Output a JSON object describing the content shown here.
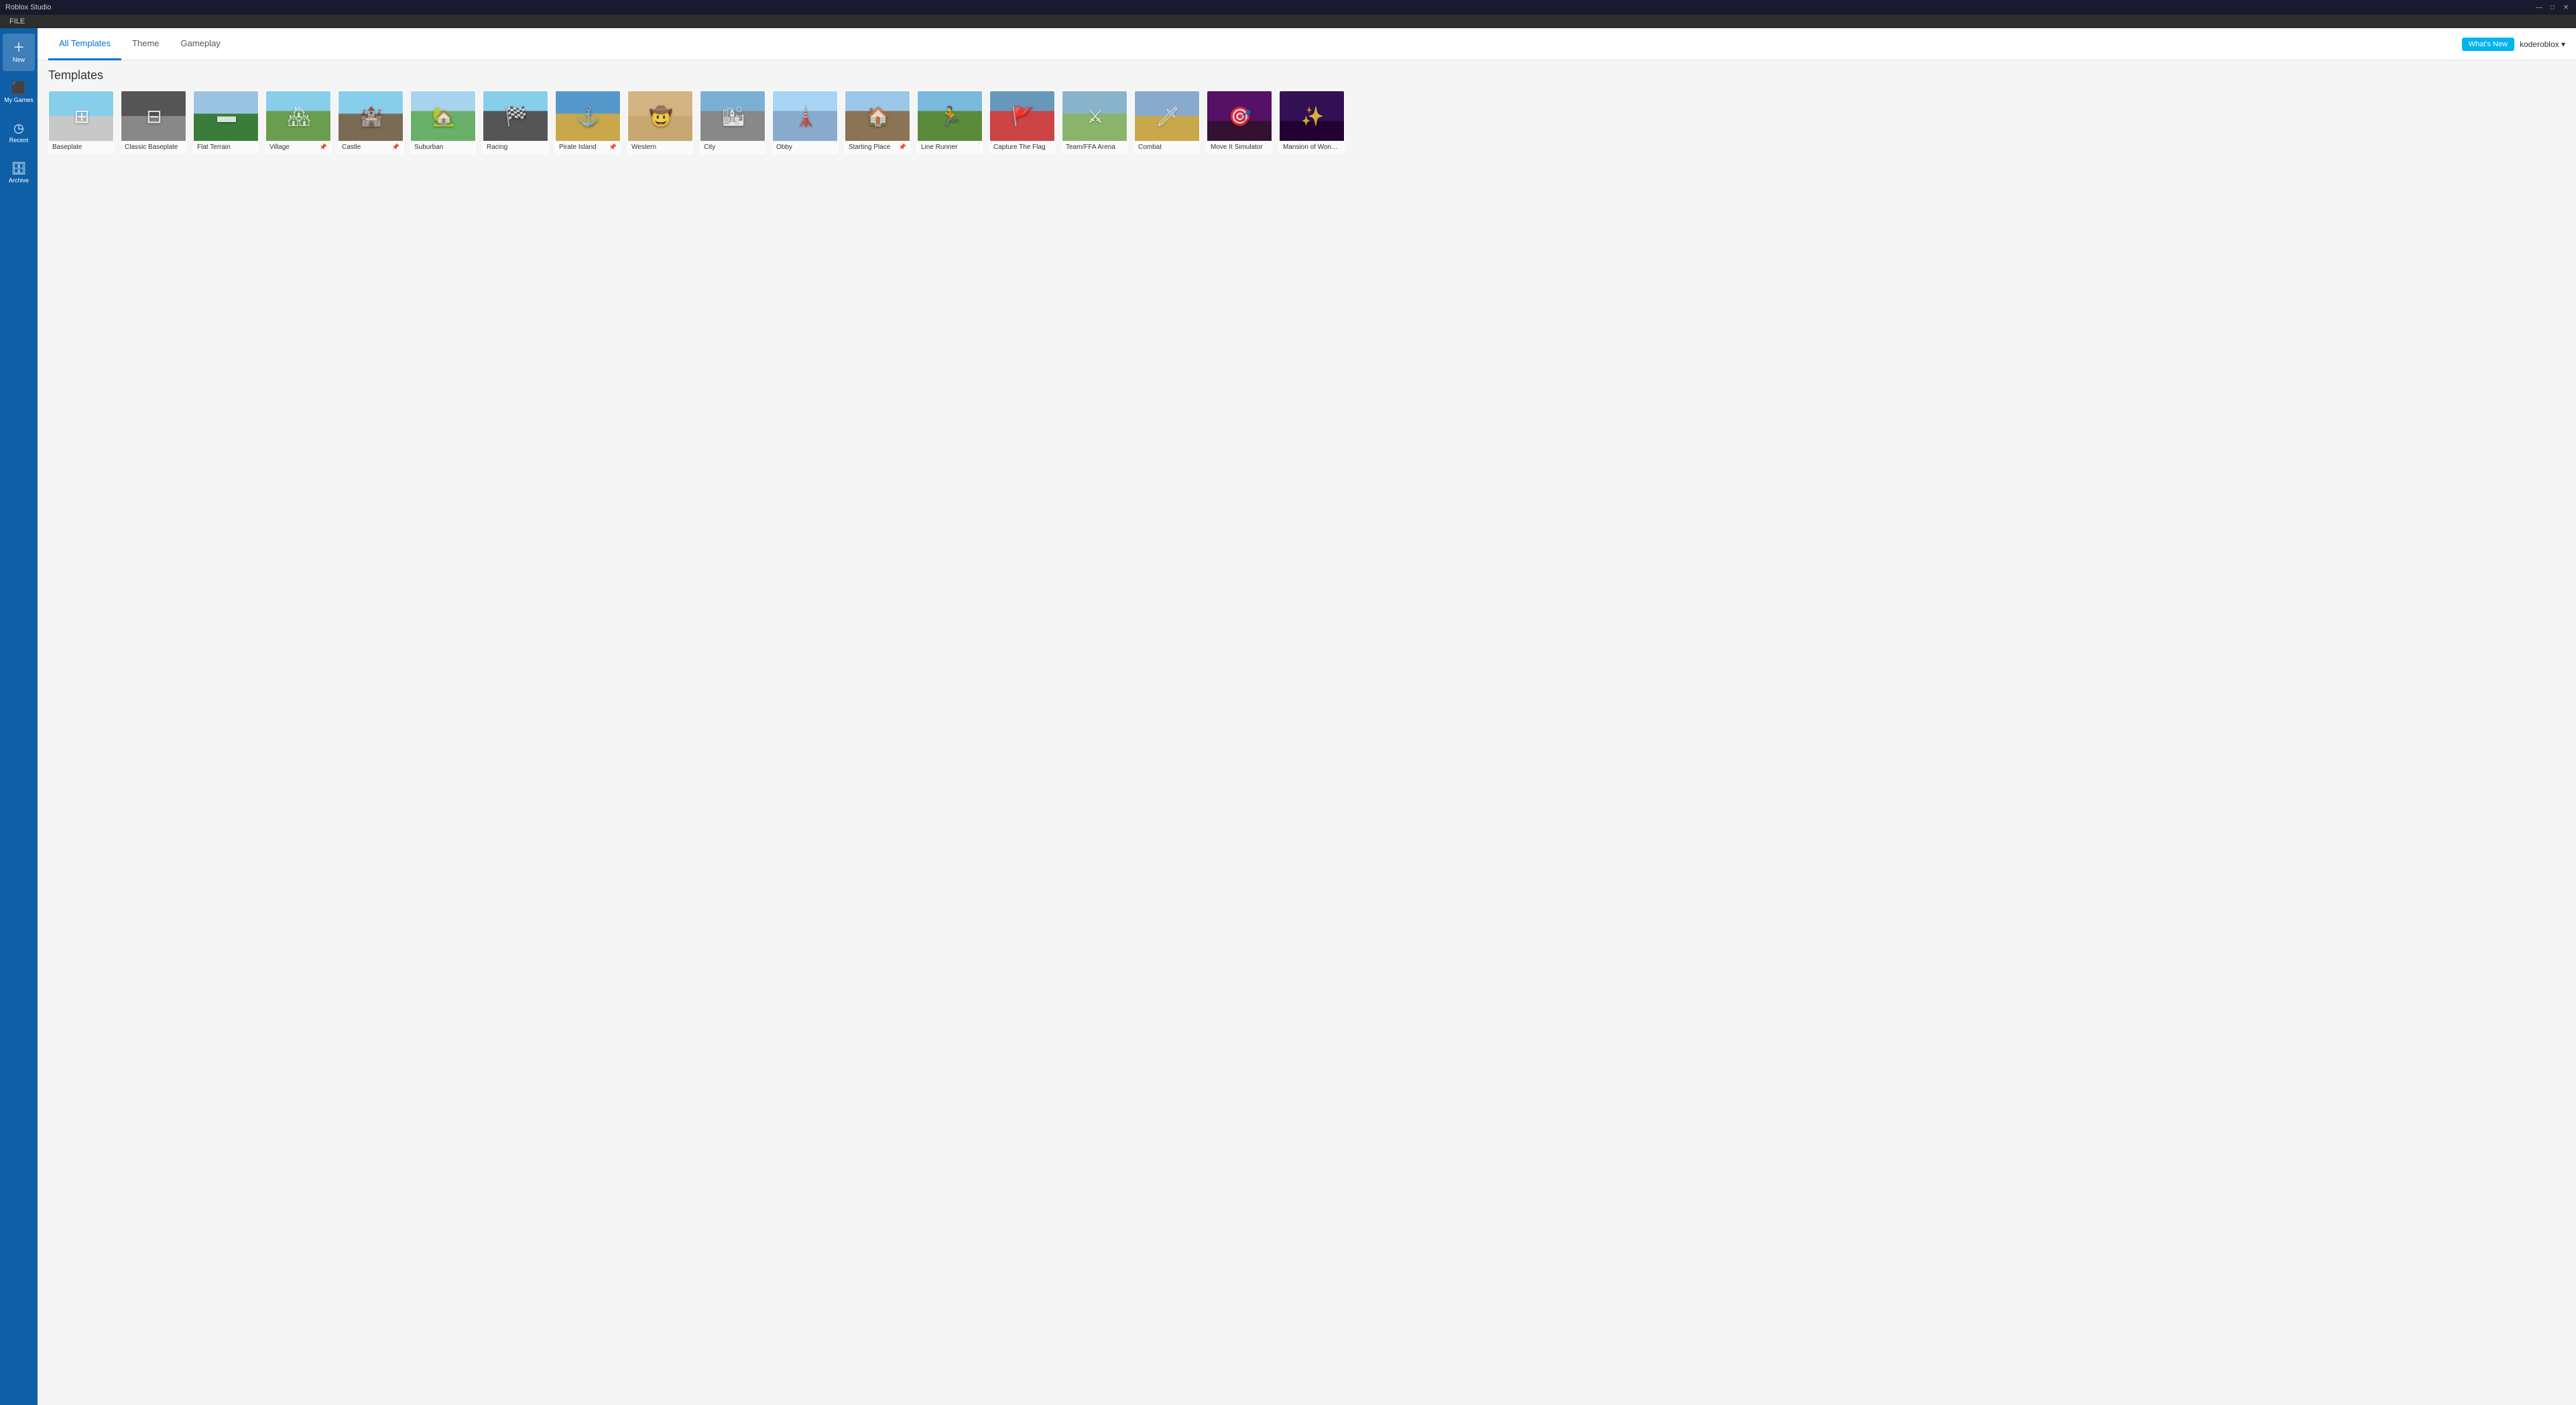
{
  "app": {
    "title": "Roblox Studio",
    "menu_items": [
      "FILE"
    ]
  },
  "title_bar": {
    "minimize": "—",
    "maximize": "□",
    "close": "✕"
  },
  "user_bar": {
    "whats_new": "What's New",
    "username": "koderoblox ▾"
  },
  "tabs": [
    {
      "id": "all-templates",
      "label": "All Templates",
      "active": true
    },
    {
      "id": "theme",
      "label": "Theme",
      "active": false
    },
    {
      "id": "gameplay",
      "label": "Gameplay",
      "active": false
    }
  ],
  "sidebar": {
    "items": [
      {
        "id": "new",
        "label": "New",
        "icon": "＋"
      },
      {
        "id": "my-games",
        "label": "My Games",
        "icon": "🎮"
      },
      {
        "id": "recent",
        "label": "Recent",
        "icon": "🕐"
      },
      {
        "id": "archive",
        "label": "Archive",
        "icon": "📁"
      }
    ]
  },
  "section_title": "Templates",
  "templates": [
    {
      "id": "baseplate",
      "name": "Baseplate",
      "thumb_class": "thumb-baseplate",
      "icon": "⊞",
      "pinned": false
    },
    {
      "id": "classic-baseplate",
      "name": "Classic Baseplate",
      "thumb_class": "thumb-classic-baseplate",
      "icon": "⊟",
      "pinned": false
    },
    {
      "id": "flat-terrain",
      "name": "Flat Terrain",
      "thumb_class": "thumb-flat-terrain",
      "icon": "▬",
      "pinned": false
    },
    {
      "id": "village",
      "name": "Village",
      "thumb_class": "thumb-village",
      "icon": "🏘",
      "pinned": true
    },
    {
      "id": "castle",
      "name": "Castle",
      "thumb_class": "thumb-castle",
      "icon": "🏰",
      "pinned": true
    },
    {
      "id": "suburban",
      "name": "Suburban",
      "thumb_class": "thumb-suburban",
      "icon": "🏡",
      "pinned": false
    },
    {
      "id": "racing",
      "name": "Racing",
      "thumb_class": "thumb-racing",
      "icon": "🏁",
      "pinned": false
    },
    {
      "id": "pirate-island",
      "name": "Pirate Island",
      "thumb_class": "thumb-pirate-island",
      "icon": "⚓",
      "pinned": true
    },
    {
      "id": "western",
      "name": "Western",
      "thumb_class": "thumb-western",
      "icon": "🤠",
      "pinned": false
    },
    {
      "id": "city",
      "name": "City",
      "thumb_class": "thumb-city",
      "icon": "🏙",
      "pinned": false
    },
    {
      "id": "obby",
      "name": "Obby",
      "thumb_class": "thumb-obby",
      "icon": "🗼",
      "pinned": false
    },
    {
      "id": "starting-place",
      "name": "Starting Place",
      "thumb_class": "thumb-starting-place",
      "icon": "🏠",
      "pinned": true
    },
    {
      "id": "line-runner",
      "name": "Line Runner",
      "thumb_class": "thumb-line-runner",
      "icon": "🏃",
      "pinned": false
    },
    {
      "id": "capture-flag",
      "name": "Capture The Flag",
      "thumb_class": "thumb-capture-flag",
      "icon": "🚩",
      "pinned": false
    },
    {
      "id": "team-ffa",
      "name": "Team/FFA Arena",
      "thumb_class": "thumb-team-ffa",
      "icon": "⚔",
      "pinned": false
    },
    {
      "id": "combat",
      "name": "Combat",
      "thumb_class": "thumb-combat",
      "icon": "🗡",
      "pinned": false
    },
    {
      "id": "move-it",
      "name": "Move It Simulator",
      "thumb_class": "thumb-move-it",
      "icon": "🎯",
      "pinned": false
    },
    {
      "id": "mansion",
      "name": "Mansion of Wonder",
      "thumb_class": "thumb-mansion",
      "icon": "✨",
      "pinned": false
    }
  ]
}
